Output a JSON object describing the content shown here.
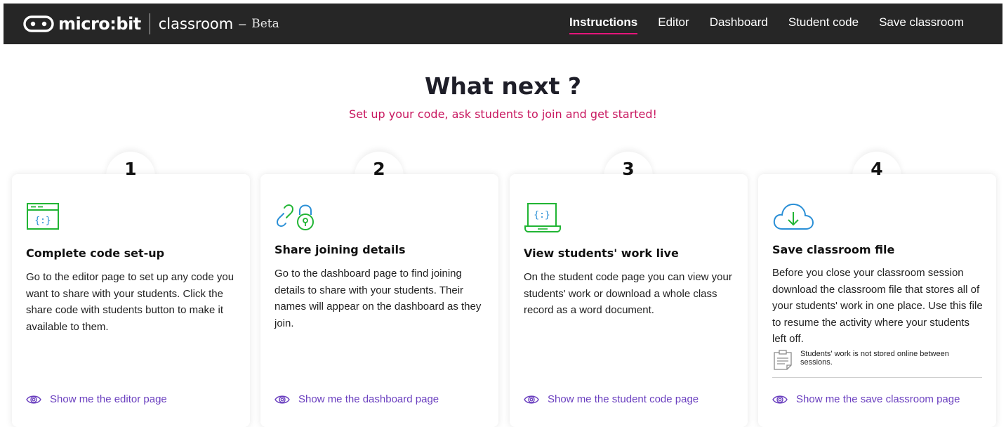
{
  "header": {
    "logo_text": "micro:bit",
    "product": "classroom",
    "dash": "–",
    "badge": "Beta",
    "nav": [
      {
        "label": "Instructions",
        "active": true
      },
      {
        "label": "Editor"
      },
      {
        "label": "Dashboard"
      },
      {
        "label": "Student code"
      },
      {
        "label": "Save classroom"
      }
    ]
  },
  "main": {
    "title": "What next ?",
    "subtitle": "Set up your code, ask students to join and get started!"
  },
  "steps": [
    {
      "number": "1",
      "icon": "code-window-icon",
      "title": "Complete code set-up",
      "body": "Go to the editor page to set up any code you want to share with your students. Click the share code with students button to make it available to them.",
      "link": "Show me the editor page"
    },
    {
      "number": "2",
      "icon": "link-lock-icon",
      "title": "Share joining details",
      "body": "Go to the dashboard page to find joining details to share with your students. Their names will appear on the dashboard as they join.",
      "link": "Show me the dashboard page"
    },
    {
      "number": "3",
      "icon": "laptop-code-icon",
      "title": "View students' work live",
      "body": "On the student code page you can view your students' work or download a whole class record as a word document.",
      "link": "Show me the student code page"
    },
    {
      "number": "4",
      "icon": "cloud-download-icon",
      "title": "Save classroom file",
      "body": "Before you close your classroom session download the classroom file that stores all of your students' work in one place. Use this file to resume the activity where your students left off.",
      "note": "Students' work is not stored online between sessions.",
      "link": "Show me the save classroom page"
    }
  ],
  "colors": {
    "header_bg": "#262626",
    "accent_pink": "#e5157a",
    "subtitle": "#c8175f",
    "link_purple": "#6a3fbf",
    "icon_green": "#21b534",
    "icon_blue": "#2a8fd6"
  }
}
